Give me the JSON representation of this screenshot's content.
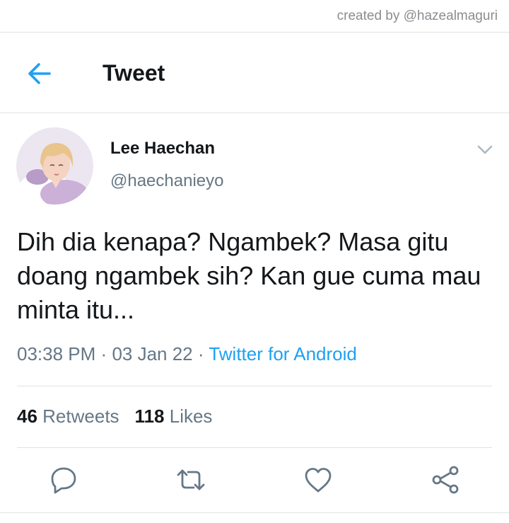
{
  "credit": "created by @hazealmaguri",
  "header": {
    "title": "Tweet",
    "back_icon": "arrow-left-icon"
  },
  "tweet": {
    "display_name": "Lee Haechan",
    "handle": "@haechanieyo",
    "text": "Dih dia kenapa? Ngambek? Masa gitu doang ngambek sih? Kan gue cuma mau minta itu...",
    "time": "03:38 PM",
    "separator": "·",
    "date": "03 Jan 22",
    "source": "Twitter for Android"
  },
  "stats": {
    "retweets_count": "46",
    "retweets_label": "Retweets",
    "likes_count": "118",
    "likes_label": "Likes"
  },
  "actions": [
    "reply-icon",
    "retweet-icon",
    "like-icon",
    "share-icon"
  ],
  "colors": {
    "accent": "#1da1f2",
    "text_primary": "#14171a",
    "text_secondary": "#657786",
    "divider": "#dfe3e6"
  }
}
